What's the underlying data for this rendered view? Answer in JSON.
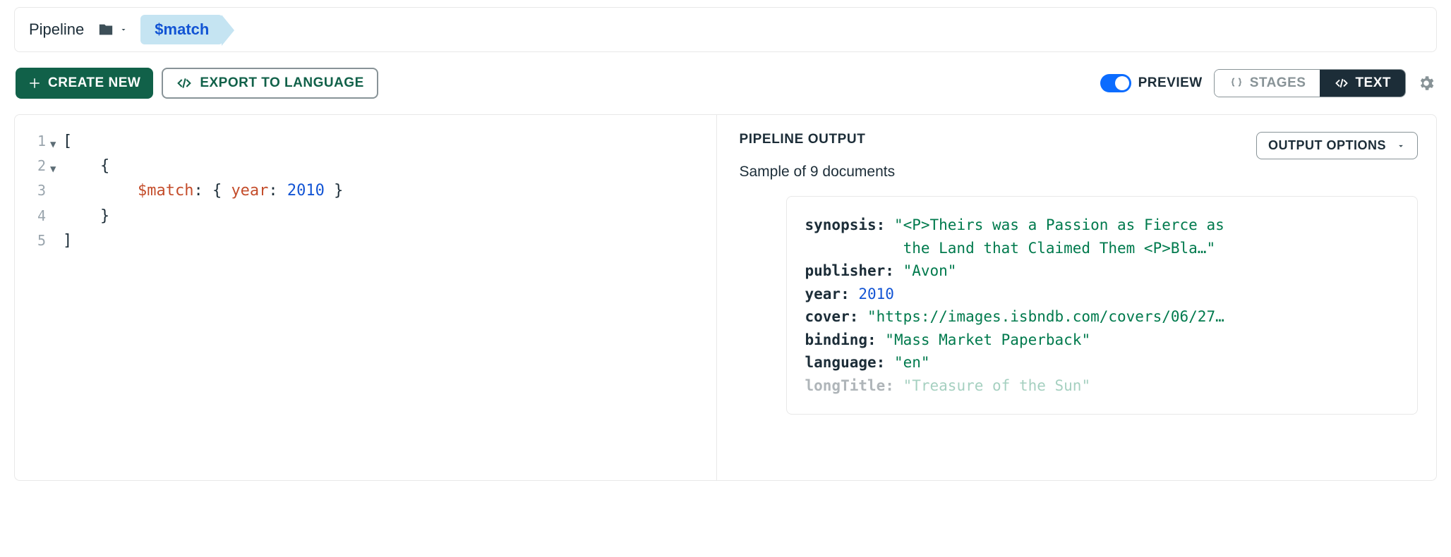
{
  "breadcrumb": {
    "label": "Pipeline",
    "stage": "$match"
  },
  "toolbar": {
    "create_label": "CREATE NEW",
    "export_label": "EXPORT TO LANGUAGE",
    "preview_label": "PREVIEW",
    "stages_label": "STAGES",
    "text_label": "TEXT"
  },
  "editor": {
    "lines": [
      "1",
      "2",
      "3",
      "4",
      "5"
    ],
    "l1": "[",
    "l2": "    {",
    "l3a": "        ",
    "l3_match": "$match",
    "l3b": ": { ",
    "l3_key": "year",
    "l3c": ": ",
    "l3_val": "2010",
    "l3d": " }",
    "l4": "    }",
    "l5": "]"
  },
  "output": {
    "title": "PIPELINE OUTPUT",
    "subtitle": "Sample of 9 documents",
    "options_label": "OUTPUT OPTIONS",
    "doc": {
      "synopsis_k": "synopsis:",
      "synopsis_v1": " \"<P>Theirs was a Passion as Fierce as",
      "synopsis_v2": "           the Land that Claimed Them <P>Bla…\"",
      "publisher_k": "publisher:",
      "publisher_v": " \"Avon\"",
      "year_k": "year:",
      "year_v": " 2010",
      "cover_k": "cover:",
      "cover_v": " \"https://images.isbndb.com/covers/06/27…",
      "binding_k": "binding:",
      "binding_v": " \"Mass Market Paperback\"",
      "language_k": "language:",
      "language_v": " \"en\"",
      "longTitle_k": "longTitle:",
      "longTitle_v": " \"Treasure of the Sun\""
    }
  }
}
